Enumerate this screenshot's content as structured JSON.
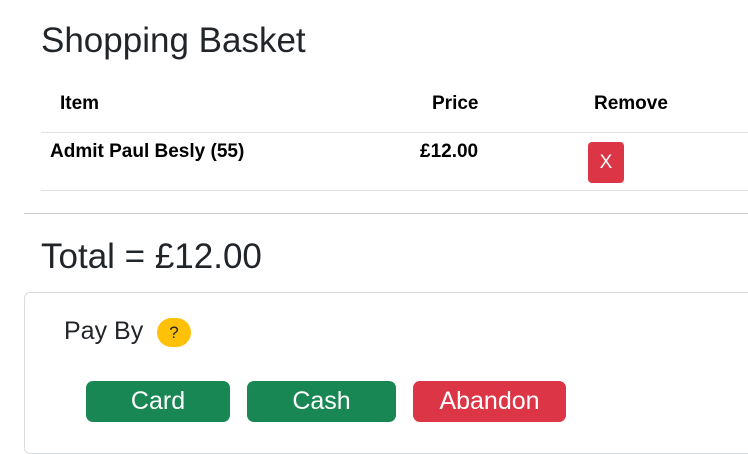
{
  "page": {
    "title": "Shopping Basket"
  },
  "basket": {
    "headers": {
      "item": "Item",
      "price": "Price",
      "remove": "Remove"
    },
    "rows": [
      {
        "item": "Admit Paul Besly (55)",
        "price": "£12.00",
        "remove_label": "X"
      }
    ]
  },
  "total": {
    "text": "Total = £12.00"
  },
  "payment": {
    "label": "Pay By",
    "help_label": "?",
    "buttons": {
      "card": "Card",
      "cash": "Cash",
      "abandon": "Abandon"
    }
  },
  "colors": {
    "success": "#198754",
    "danger": "#dc3545",
    "warning": "#ffc107"
  },
  "icons": {
    "help": "question-mark-icon",
    "remove": "close-icon"
  }
}
